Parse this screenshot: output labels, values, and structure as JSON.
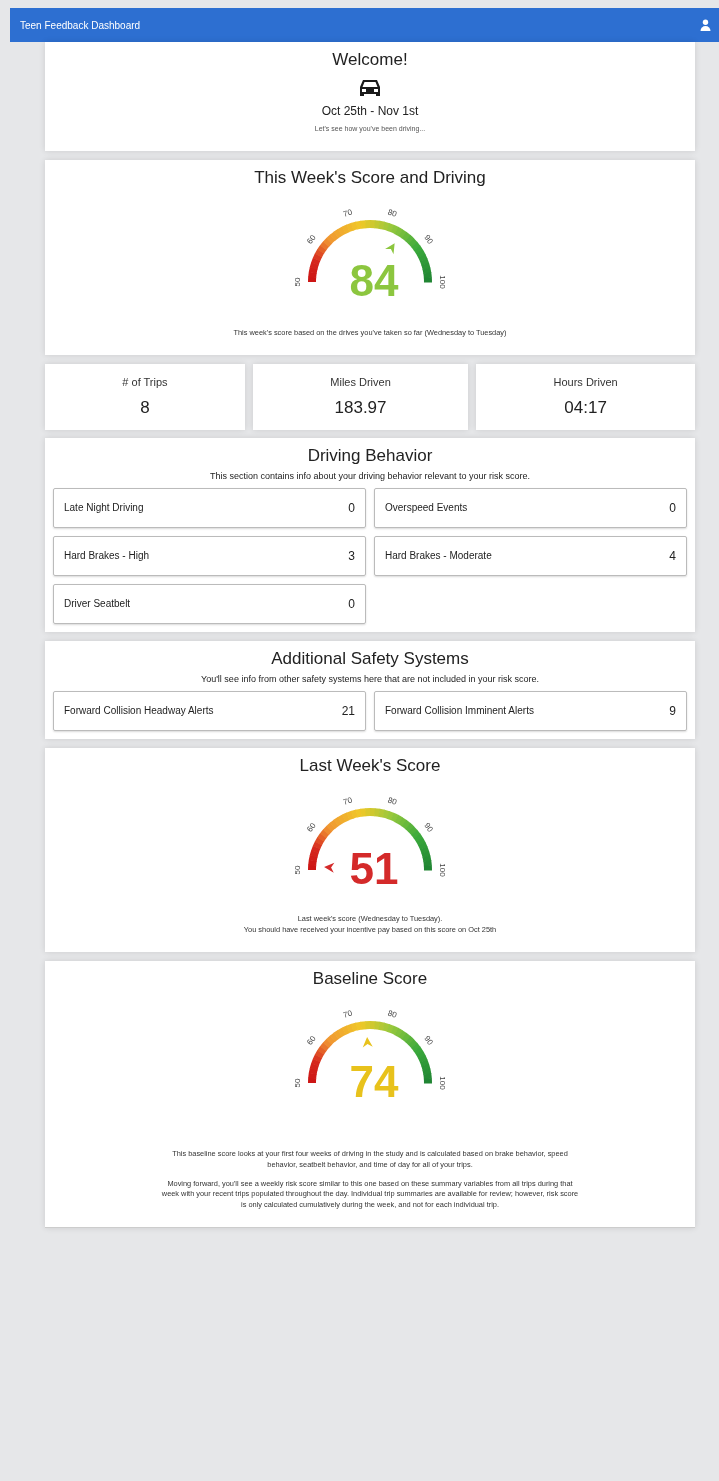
{
  "navbar": {
    "title": "Teen Feedback Dashboard"
  },
  "welcome": {
    "title": "Welcome!",
    "dates": "Oct 25th - Nov 1st",
    "subtitle": "Let's see how you've been driving..."
  },
  "this_week": {
    "title": "This Week's Score and Driving",
    "gauge": {
      "score": "84",
      "color": "#8cc63f",
      "ticks": [
        "50",
        "60",
        "70",
        "80",
        "90",
        "100"
      ]
    },
    "notes": [
      "This week's score based on the drives you've taken so far (Wednesday to Tuesday)"
    ]
  },
  "stats": [
    {
      "label": "# of Trips",
      "value": "8"
    },
    {
      "label": "Miles Driven",
      "value": "183.97"
    },
    {
      "label": "Hours Driven",
      "value": "04:17"
    }
  ],
  "driving_behavior": {
    "title": "Driving Behavior",
    "subtitle": "This section contains info about your driving behavior relevant to your risk score.",
    "items": [
      {
        "label": "Late Night Driving",
        "value": "0"
      },
      {
        "label": "Overspeed Events",
        "value": "0"
      },
      {
        "label": "Hard Brakes - High",
        "value": "3"
      },
      {
        "label": "Hard Brakes - Moderate",
        "value": "4"
      },
      {
        "label": "Driver Seatbelt",
        "value": "0"
      }
    ]
  },
  "additional_safety": {
    "title": "Additional Safety Systems",
    "subtitle": "You'll see info from other safety systems here that are not included in your risk score.",
    "items": [
      {
        "label": "Forward Collision Headway Alerts",
        "value": "21"
      },
      {
        "label": "Forward Collision Imminent Alerts",
        "value": "9"
      }
    ]
  },
  "last_week": {
    "title": "Last Week's Score",
    "gauge": {
      "score": "51",
      "color": "#d42a2a",
      "ticks": [
        "50",
        "60",
        "70",
        "80",
        "90",
        "100"
      ]
    },
    "notes": [
      "Last week's score (Wednesday to Tuesday).\nYou should have received your incentive pay based on this score on Oct 25th"
    ]
  },
  "baseline": {
    "title": "Baseline Score",
    "gauge": {
      "score": "74",
      "color": "#e8c21c",
      "ticks": [
        "50",
        "60",
        "70",
        "80",
        "90",
        "100"
      ]
    },
    "notes": [
      "This baseline score looks at your first four weeks of driving in the study and is calculated based on brake behavior, speed behavior, seatbelt behavior, and time of day for all of your trips.",
      "Moving forward, you'll see a weekly risk score similar to this one based on these summary variables from all trips during that week with your recent trips populated throughout the day. Individual trip summaries are available for review; however, risk score is only calculated cumulatively during the week, and not for each individual trip."
    ]
  }
}
